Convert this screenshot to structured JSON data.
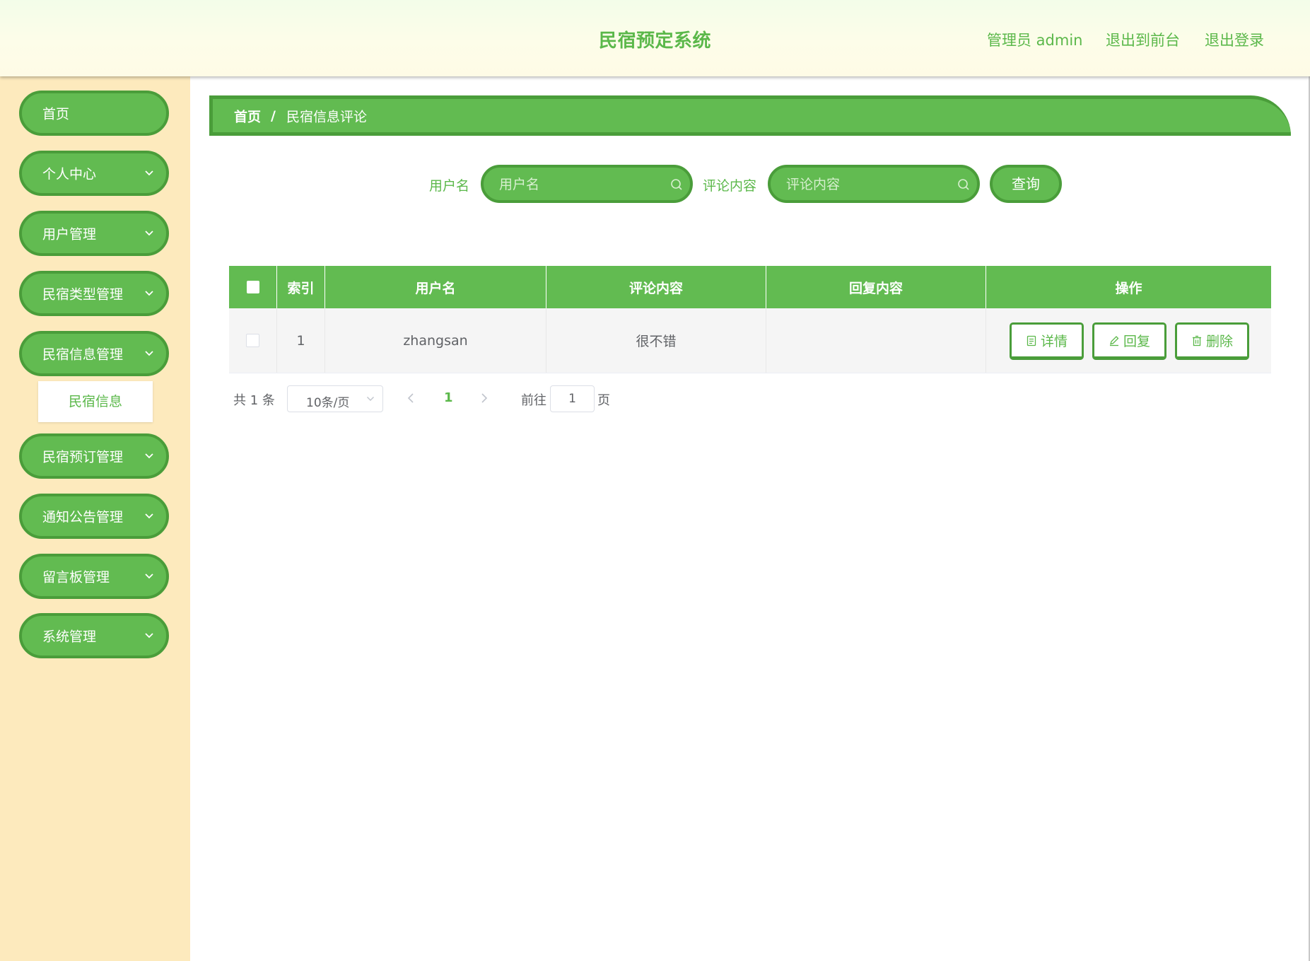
{
  "header": {
    "title": "民宿预定系统",
    "admin_label": "管理员 admin",
    "front_link": "退出到前台",
    "logout_link": "退出登录"
  },
  "sidebar": {
    "items": [
      {
        "label": "首页"
      },
      {
        "label": "个人中心"
      },
      {
        "label": "用户管理"
      },
      {
        "label": "民宿类型管理"
      },
      {
        "label": "民宿信息管理"
      },
      {
        "label": "民宿预订管理"
      },
      {
        "label": "通知公告管理"
      },
      {
        "label": "留言板管理"
      },
      {
        "label": "系统管理"
      }
    ],
    "sub_item": "民宿信息"
  },
  "breadcrumb": {
    "home": "首页",
    "separator": "/",
    "current": "民宿信息评论"
  },
  "search": {
    "username_label": "用户名",
    "username_placeholder": "用户名",
    "comment_label": "评论内容",
    "comment_placeholder": "评论内容",
    "query_button": "查询"
  },
  "table": {
    "headers": [
      "索引",
      "用户名",
      "评论内容",
      "回复内容",
      "操作"
    ],
    "rows": [
      {
        "index": "1",
        "username": "zhangsan",
        "comment": "很不错",
        "reply": ""
      }
    ],
    "actions": {
      "detail": "详情",
      "reply": "回复",
      "delete": "删除"
    }
  },
  "pagination": {
    "total": "共 1 条",
    "page_size": "10条/页",
    "current_page": "1",
    "goto_label": "前往",
    "goto_value": "1",
    "page_unit": "页"
  },
  "colors": {
    "primary": "#62bb51",
    "primary_dark": "#4a9d3a",
    "sidebar_bg": "#fdeabd"
  }
}
